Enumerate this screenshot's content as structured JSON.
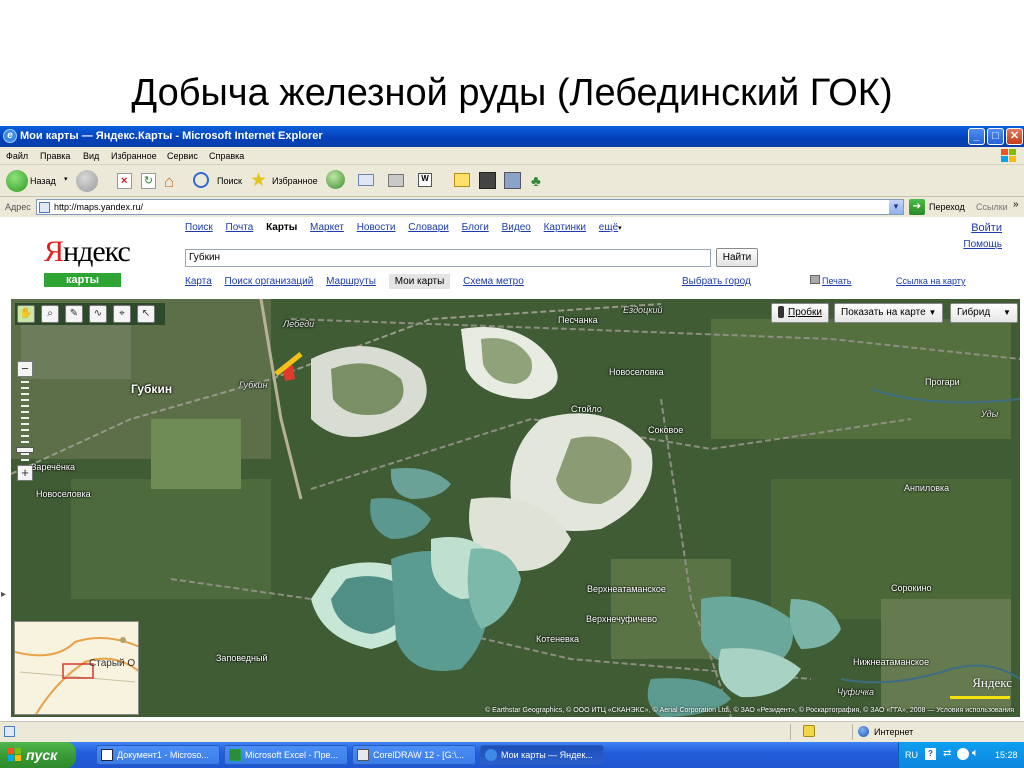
{
  "slide": {
    "title": "Добыча железной руды (Лебединский ГОК)"
  },
  "window": {
    "title": "Мои карты — Яндекс.Карты - Microsoft Internet Explorer",
    "buttons": {
      "minimize": "_",
      "maximize": "□",
      "close": "✕"
    }
  },
  "menu": [
    "Файл",
    "Правка",
    "Вид",
    "Избранное",
    "Сервис",
    "Справка"
  ],
  "toolbar": {
    "back": "Назад",
    "search": "Поиск",
    "favorites": "Избранное"
  },
  "address": {
    "label": "Адрес",
    "url": "http://maps.yandex.ru/",
    "go": "Переход",
    "links": "Ссылки"
  },
  "yandex": {
    "logo_first": "Я",
    "logo_rest": "ндекс",
    "service": "карты",
    "top_links": [
      "Поиск",
      "Почта",
      "Карты",
      "Маркет",
      "Новости",
      "Словари",
      "Блоги",
      "Видео",
      "Картинки",
      "ещё"
    ],
    "login": "Войти",
    "help": "Помощь",
    "search_value": "Губкин",
    "search_button": "Найти",
    "nav_links": [
      "Карта",
      "Поиск организаций",
      "Маршруты",
      "Мои карты",
      "Схема метро"
    ],
    "pick_city": "Выбрать город",
    "print": "Печать",
    "map_link": "Ссылка на карту"
  },
  "map": {
    "traffic_btn": "Пробки",
    "show_on_map": "Показать на карте",
    "layer": "Гибрид",
    "labels": {
      "lebedi": "Лебеди",
      "peschanka": "Песчанка",
      "ezdotsky": "Ездоцкий",
      "gubkin": "Губкин",
      "gubkin_small": "Губкин",
      "novoselovka_e": "Новоселовка",
      "progary": "Прогари",
      "stoylo": "Стойло",
      "sokovoe": "Соковое",
      "uda": "Уды",
      "zarechenka": "Заречёнка",
      "novoselovka_w": "Новоселовка",
      "anpilovka": "Анпиловка",
      "verkhneataman": "Верхнеатаманское",
      "sorokino": "Сорокино",
      "verkhnechufichevo": "Верхнечуфичево",
      "kotenevka": "Котеневка",
      "zapovedny": "Заповедный",
      "nizhneataman": "Нижнеатаманское",
      "chufichka": "Чуфичка",
      "stary_oskol": "Старый О",
      "watermark": "Яндекс"
    },
    "copyright": "© Earthstar Geographics, © ООО ИТЦ «СКАНЭКС», © Aerial Corporation Ltd., © ЗАО «Резидент», © Роскартография, © ЗАО «ГГА», 2008 — Условия использования"
  },
  "status": {
    "zone": "Интернет"
  },
  "taskbar": {
    "start": "пуск",
    "tasks": [
      "Документ1 - Microso...",
      "Microsoft Excel - Пре...",
      "CorelDRAW 12 - [G:\\...",
      "Мои карты — Яндек..."
    ],
    "lang": "RU",
    "time": "15:28"
  },
  "colors": {
    "xp_blue": "#0a5fdc",
    "start_green": "#3a9b36",
    "yandex_red": "#e51c1c",
    "yandex_green": "#2ea532",
    "link_blue": "#1c3caa"
  }
}
